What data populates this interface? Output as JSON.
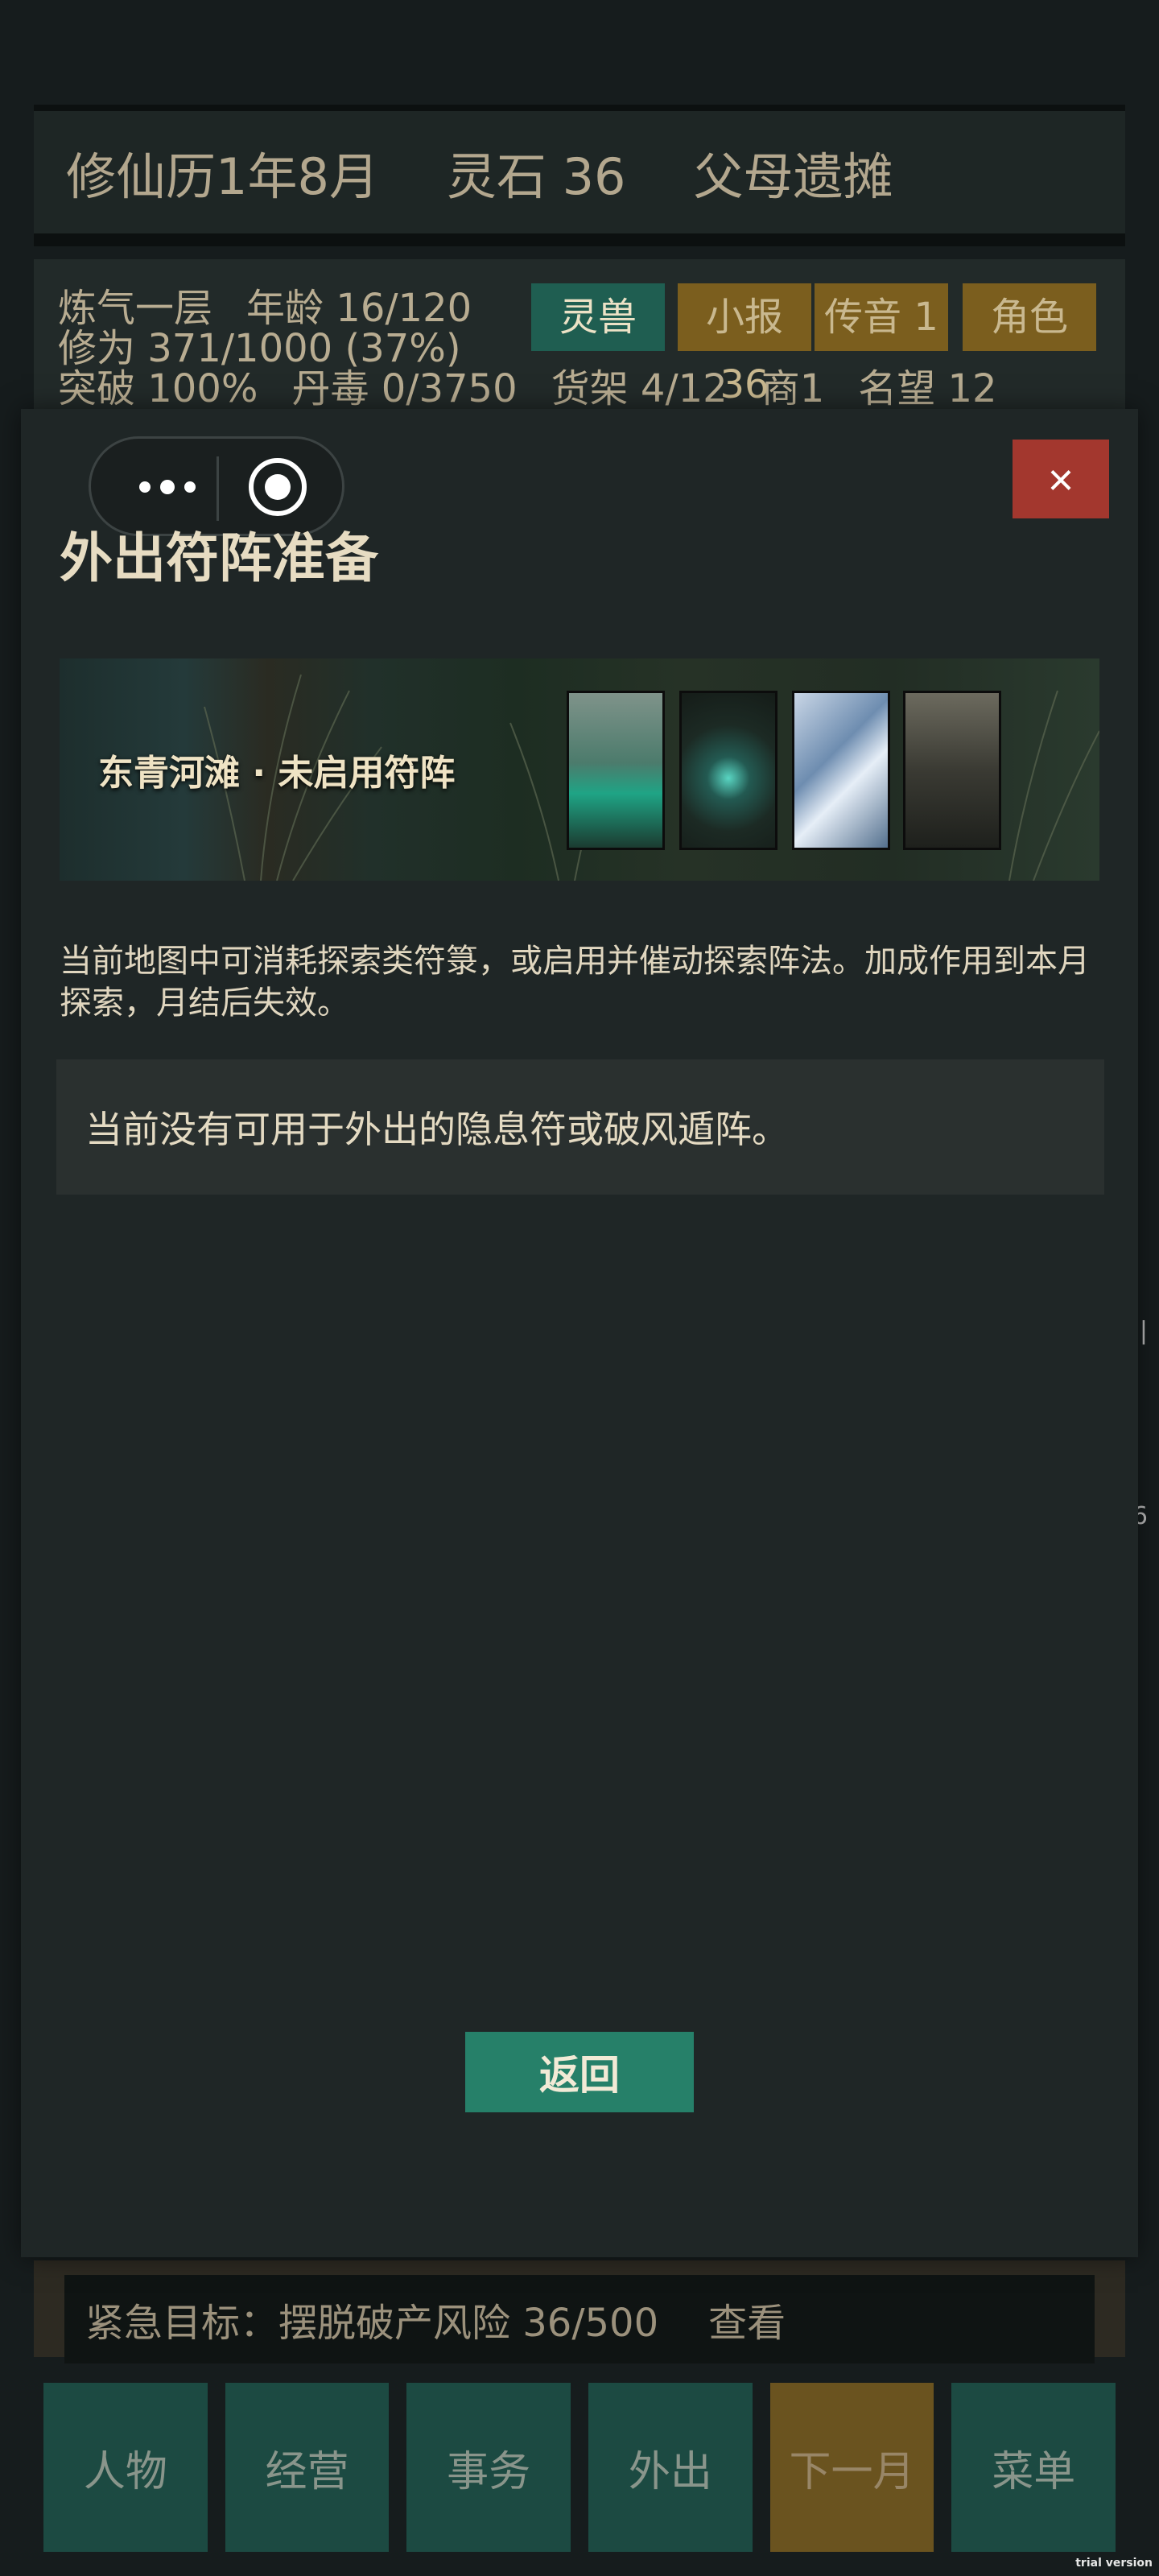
{
  "top_bar": {
    "date": "修仙历1年8月",
    "spirit_stones": "灵石 36",
    "location": "父母遗摊"
  },
  "status": {
    "realm": "炼气一层",
    "age": "年龄 16/120",
    "cultivation": "修为 371/1000 (37%)",
    "breakthrough": "突破 100%",
    "pill_poison": "丹毒 0/3750",
    "shelf": "货架 4/12",
    "merchant": "商1",
    "reputation": "名望 12"
  },
  "quick_buttons": {
    "spirit_beast": "灵兽",
    "news": "小报 36",
    "messages": "传音 1",
    "character": "角色"
  },
  "modal": {
    "title": "外出符阵准备",
    "close_label": "×",
    "banner_label": "东青河滩 · 未启用符阵",
    "description": "当前地图中可消耗探索类符箓，或启用并催动探索阵法。加成作用到本月探索，月结后失效。",
    "empty_message": "当前没有可用于外出的隐息符或破风遁阵。",
    "back_label": "返回"
  },
  "goal_bar": {
    "text": "紧急目标：摆脱破产风险 36/500",
    "view_label": "查看"
  },
  "bottom_nav": [
    "人物",
    "经营",
    "事务",
    "外出",
    "下一月",
    "菜单"
  ],
  "edge_glyphs": [
    "|",
    "6"
  ],
  "watermark": "trial version"
}
